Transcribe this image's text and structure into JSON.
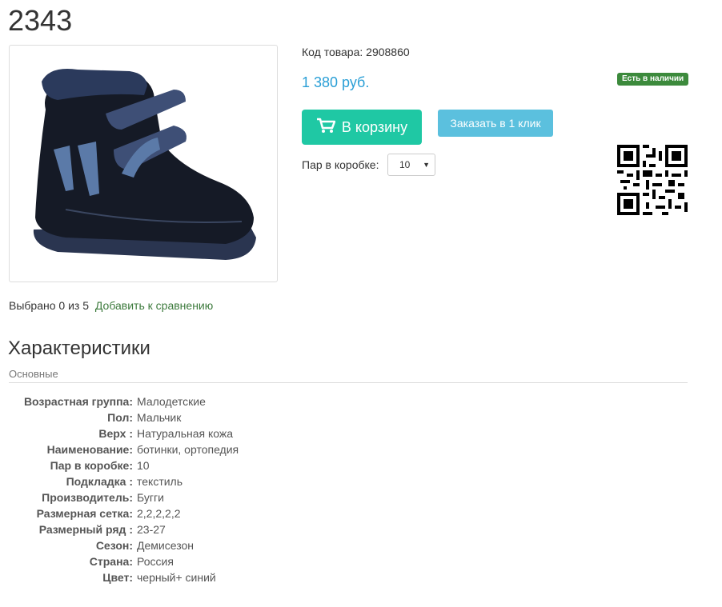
{
  "product": {
    "title": "2343",
    "code_text": "Код товара: 2908860",
    "price": "1 380 руб.",
    "stock_badge": "Есть в наличии",
    "cart_button": "В корзину",
    "one_click_button": "Заказать в 1 клик",
    "box_label": "Пар в коробке:",
    "box_select_value": "10"
  },
  "compare": {
    "selected_text": "Выбрано 0 из 5",
    "link_text": "Добавить к сравнению"
  },
  "specs": {
    "heading": "Характеристики",
    "group": "Основные",
    "rows": [
      {
        "key": "Возрастная группа:",
        "value": "Малодетские"
      },
      {
        "key": "Пол:",
        "value": "Мальчик"
      },
      {
        "key": "Верх :",
        "value": "Натуральная кожа"
      },
      {
        "key": "Наименование:",
        "value": "ботинки, ортопедия"
      },
      {
        "key": "Пар в коробке:",
        "value": "10"
      },
      {
        "key": "Подкладка :",
        "value": "текстиль"
      },
      {
        "key": "Производитель:",
        "value": "Бугги"
      },
      {
        "key": "Размерная сетка:",
        "value": "2,2,2,2,2"
      },
      {
        "key": "Размерный ряд :",
        "value": "23-27"
      },
      {
        "key": "Сезон:",
        "value": "Демисезон"
      },
      {
        "key": "Страна:",
        "value": "Россия"
      },
      {
        "key": "Цвет:",
        "value": "черный+ синий"
      }
    ]
  },
  "colors": {
    "price": "#2a9fd6",
    "cart_button": "#1fc8a4",
    "one_click_button": "#5bc0de",
    "stock_badge": "#3c8a3c",
    "compare_link": "#3c7a3c"
  },
  "icons": {
    "cart": "cart-icon",
    "select_caret": "triangle-down",
    "qr": "qr-code"
  }
}
